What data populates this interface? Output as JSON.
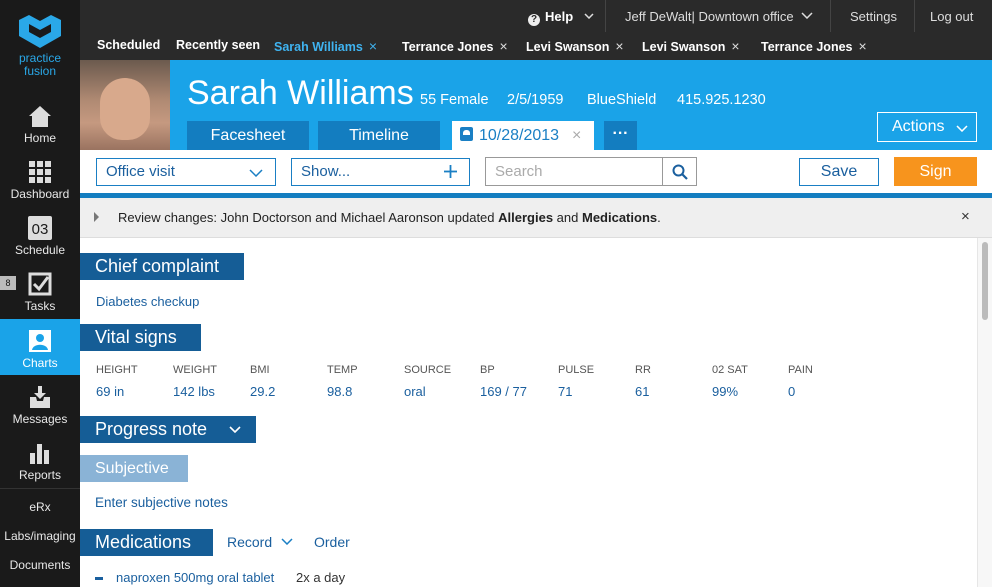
{
  "brand": {
    "logo_line1": "practice",
    "logo_line2": "fusion"
  },
  "nav": {
    "items": [
      {
        "label": "Home",
        "icon": "home-icon"
      },
      {
        "label": "Dashboard",
        "icon": "grid-icon"
      },
      {
        "label": "Schedule",
        "icon": "calendar-icon",
        "day": "03"
      },
      {
        "label": "Tasks",
        "icon": "checkbox-icon",
        "badge": "8"
      },
      {
        "label": "Charts",
        "icon": "person-icon",
        "active": true
      },
      {
        "label": "Messages",
        "icon": "inbox-icon"
      },
      {
        "label": "Reports",
        "icon": "bar-chart-icon"
      }
    ],
    "text_items": [
      "eRx",
      "Labs/imaging",
      "Documents"
    ]
  },
  "topbar": {
    "help": "Help",
    "user": "Jeff DeWalt| Downtown office",
    "settings": "Settings",
    "logout": "Log out"
  },
  "tabs": {
    "scheduled": "Scheduled",
    "recent": "Recently seen",
    "open": [
      "Sarah Williams",
      "Terrance Jones",
      "Levi Swanson",
      "Levi Swanson",
      "Terrance Jones"
    ],
    "close_glyph": "×"
  },
  "patient": {
    "name": "Sarah Williams",
    "age_sex": "55 Female",
    "dob": "2/5/1959",
    "insurance": "BlueShield",
    "phone": "415.925.1230"
  },
  "header_tabs": {
    "facesheet": "Facesheet",
    "timeline": "Timeline",
    "encounter_date": "10/28/2013",
    "more": "···",
    "actions": "Actions"
  },
  "toolbar": {
    "visit_type": "Office visit",
    "show": "Show...",
    "search_placeholder": "Search",
    "save": "Save",
    "sign": "Sign"
  },
  "review": {
    "prefix": "Review changes:  John Doctorson and Michael Aaronson updated ",
    "item1": "Allergies",
    "and": " and ",
    "item2": "Medications",
    "suffix": "."
  },
  "chief_complaint": {
    "title": "Chief complaint",
    "value": "Diabetes checkup"
  },
  "vitals": {
    "title": "Vital signs",
    "items": [
      {
        "label": "HEIGHT",
        "value": "69  in"
      },
      {
        "label": "WEIGHT",
        "value": "142  lbs"
      },
      {
        "label": "BMI",
        "value": "29.2"
      },
      {
        "label": "TEMP",
        "value": "98.8"
      },
      {
        "label": "SOURCE",
        "value": "oral"
      },
      {
        "label": "BP",
        "value": "169 / 77"
      },
      {
        "label": "PULSE",
        "value": "71"
      },
      {
        "label": "RR",
        "value": "61"
      },
      {
        "label": "02 SAT",
        "value": "99%"
      },
      {
        "label": "PAIN",
        "value": "0"
      }
    ]
  },
  "progress_note": {
    "title": "Progress note"
  },
  "subjective": {
    "title": "Subjective",
    "placeholder": "Enter subjective notes"
  },
  "medications": {
    "title": "Medications",
    "record": "Record",
    "order": "Order",
    "items": [
      {
        "name": "naproxen 500mg oral tablet",
        "freq": "2x a day"
      }
    ]
  },
  "colors": {
    "brand_blue": "#1aa3e8",
    "dark_blue": "#155d96",
    "sign_orange": "#f7941d"
  }
}
